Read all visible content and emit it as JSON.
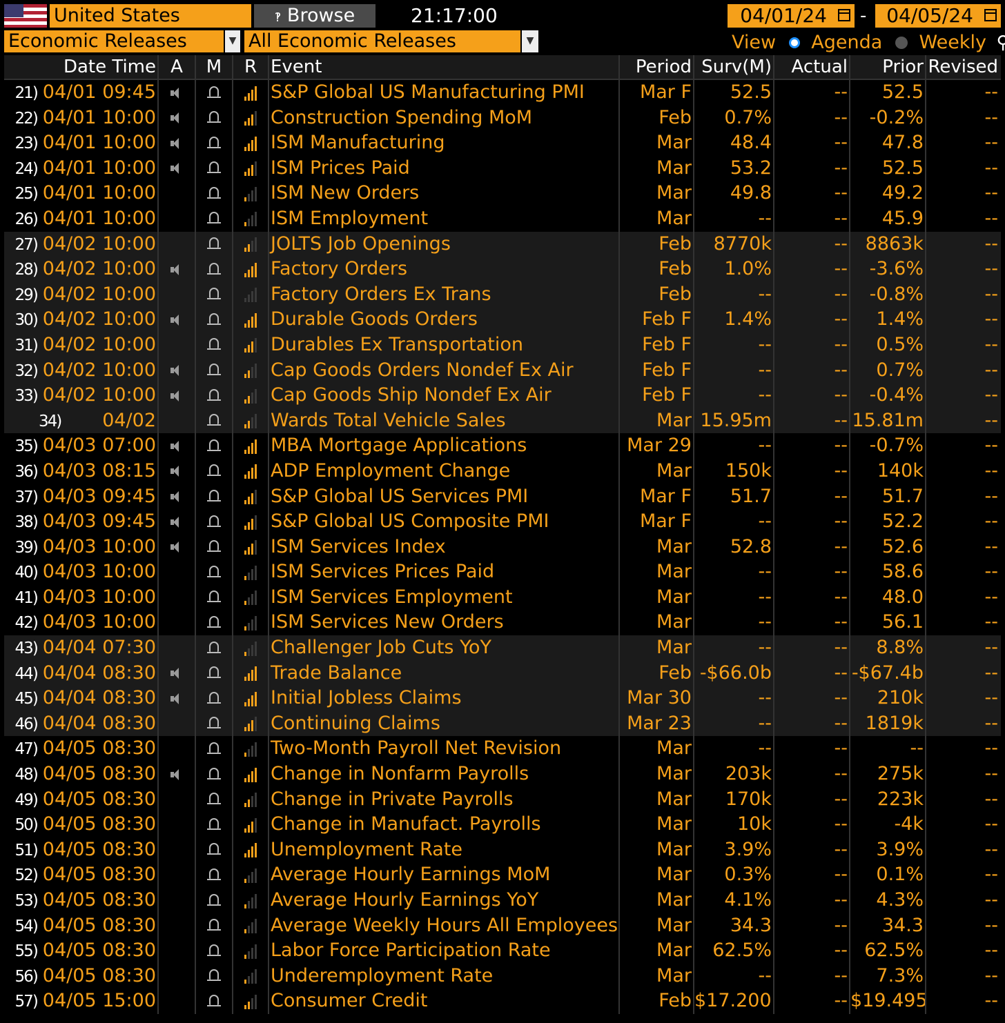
{
  "header": {
    "country": "United States",
    "browse_label": "Browse",
    "clock": "21:17:00",
    "date_from": "04/01/24",
    "date_to": "04/05/24",
    "date_separator": "-",
    "category": "Economic Releases",
    "filter": "All Economic Releases",
    "view_label": "View",
    "view_agenda": "Agenda",
    "view_weekly": "Weekly"
  },
  "columns": {
    "datetime": "Date Time",
    "a": "A",
    "m": "M",
    "r": "R",
    "event": "Event",
    "period": "Period",
    "surv": "Surv(M)",
    "actual": "Actual",
    "prior": "Prior",
    "revised": "Revised"
  },
  "rows": [
    {
      "num": "21)",
      "dt": "04/01 09:45",
      "alert": true,
      "rel": 4,
      "event": "S&P Global US Manufacturing PMI",
      "period": "Mar F",
      "surv": "52.5",
      "actual": "--",
      "prior": "52.5",
      "revised": "--"
    },
    {
      "num": "22)",
      "dt": "04/01 10:00",
      "alert": true,
      "rel": 3,
      "event": "Construction Spending MoM",
      "period": "Feb",
      "surv": "0.7%",
      "actual": "--",
      "prior": "-0.2%",
      "revised": "--"
    },
    {
      "num": "23)",
      "dt": "04/01 10:00",
      "alert": true,
      "rel": 4,
      "event": "ISM Manufacturing",
      "period": "Mar",
      "surv": "48.4",
      "actual": "--",
      "prior": "47.8",
      "revised": "--"
    },
    {
      "num": "24)",
      "dt": "04/01 10:00",
      "alert": true,
      "rel": 3,
      "event": "ISM Prices Paid",
      "period": "Mar",
      "surv": "53.2",
      "actual": "--",
      "prior": "52.5",
      "revised": "--"
    },
    {
      "num": "25)",
      "dt": "04/01 10:00",
      "alert": false,
      "rel": 1,
      "event": "ISM New Orders",
      "period": "Mar",
      "surv": "49.8",
      "actual": "--",
      "prior": "49.2",
      "revised": "--"
    },
    {
      "num": "26)",
      "dt": "04/01 10:00",
      "alert": false,
      "rel": 1,
      "event": "ISM Employment",
      "period": "Mar",
      "surv": "--",
      "actual": "--",
      "prior": "45.9",
      "revised": "--"
    },
    {
      "num": "27)",
      "dt": "04/02 10:00",
      "alert": false,
      "rel": 2,
      "event": "JOLTS Job Openings",
      "period": "Feb",
      "surv": "8770k",
      "actual": "--",
      "prior": "8863k",
      "revised": "--"
    },
    {
      "num": "28)",
      "dt": "04/02 10:00",
      "alert": true,
      "rel": 4,
      "event": "Factory Orders",
      "period": "Feb",
      "surv": "1.0%",
      "actual": "--",
      "prior": "-3.6%",
      "revised": "--"
    },
    {
      "num": "29)",
      "dt": "04/02 10:00",
      "alert": false,
      "rel": 0,
      "event": "Factory Orders Ex Trans",
      "period": "Feb",
      "surv": "--",
      "actual": "--",
      "prior": "-0.8%",
      "revised": "--"
    },
    {
      "num": "30)",
      "dt": "04/02 10:00",
      "alert": true,
      "rel": 4,
      "event": "Durable Goods Orders",
      "period": "Feb F",
      "surv": "1.4%",
      "actual": "--",
      "prior": "1.4%",
      "revised": "--"
    },
    {
      "num": "31)",
      "dt": "04/02 10:00",
      "alert": false,
      "rel": 3,
      "event": "Durables Ex Transportation",
      "period": "Feb F",
      "surv": "--",
      "actual": "--",
      "prior": "0.5%",
      "revised": "--"
    },
    {
      "num": "32)",
      "dt": "04/02 10:00",
      "alert": true,
      "rel": 2,
      "event": "Cap Goods Orders Nondef Ex Air",
      "period": "Feb F",
      "surv": "--",
      "actual": "--",
      "prior": "0.7%",
      "revised": "--"
    },
    {
      "num": "33)",
      "dt": "04/02 10:00",
      "alert": true,
      "rel": 2,
      "event": "Cap Goods Ship Nondef Ex Air",
      "period": "Feb F",
      "surv": "--",
      "actual": "--",
      "prior": "-0.4%",
      "revised": "--"
    },
    {
      "num": "34)",
      "dt": "04/02",
      "alert": false,
      "rel": 2,
      "event": "Wards Total Vehicle Sales",
      "period": "Mar",
      "surv": "15.95m",
      "actual": "--",
      "prior": "15.81m",
      "revised": "--"
    },
    {
      "num": "35)",
      "dt": "04/03 07:00",
      "alert": true,
      "rel": 4,
      "event": "MBA Mortgage Applications",
      "period": "Mar 29",
      "surv": "--",
      "actual": "--",
      "prior": "-0.7%",
      "revised": "--"
    },
    {
      "num": "36)",
      "dt": "04/03 08:15",
      "alert": true,
      "rel": 4,
      "event": "ADP Employment Change",
      "period": "Mar",
      "surv": "150k",
      "actual": "--",
      "prior": "140k",
      "revised": "--"
    },
    {
      "num": "37)",
      "dt": "04/03 09:45",
      "alert": true,
      "rel": 3,
      "event": "S&P Global US Services PMI",
      "period": "Mar F",
      "surv": "51.7",
      "actual": "--",
      "prior": "51.7",
      "revised": "--"
    },
    {
      "num": "38)",
      "dt": "04/03 09:45",
      "alert": true,
      "rel": 3,
      "event": "S&P Global US Composite PMI",
      "period": "Mar F",
      "surv": "--",
      "actual": "--",
      "prior": "52.2",
      "revised": "--"
    },
    {
      "num": "39)",
      "dt": "04/03 10:00",
      "alert": true,
      "rel": 3,
      "event": "ISM Services Index",
      "period": "Mar",
      "surv": "52.8",
      "actual": "--",
      "prior": "52.6",
      "revised": "--"
    },
    {
      "num": "40)",
      "dt": "04/03 10:00",
      "alert": false,
      "rel": 1,
      "event": "ISM Services Prices Paid",
      "period": "Mar",
      "surv": "--",
      "actual": "--",
      "prior": "58.6",
      "revised": "--"
    },
    {
      "num": "41)",
      "dt": "04/03 10:00",
      "alert": false,
      "rel": 1,
      "event": "ISM Services Employment",
      "period": "Mar",
      "surv": "--",
      "actual": "--",
      "prior": "48.0",
      "revised": "--"
    },
    {
      "num": "42)",
      "dt": "04/03 10:00",
      "alert": false,
      "rel": 1,
      "event": "ISM Services New Orders",
      "period": "Mar",
      "surv": "--",
      "actual": "--",
      "prior": "56.1",
      "revised": "--"
    },
    {
      "num": "43)",
      "dt": "04/04 07:30",
      "alert": false,
      "rel": 1,
      "event": "Challenger Job Cuts YoY",
      "period": "Mar",
      "surv": "--",
      "actual": "--",
      "prior": "8.8%",
      "revised": "--"
    },
    {
      "num": "44)",
      "dt": "04/04 08:30",
      "alert": true,
      "rel": 4,
      "event": "Trade Balance",
      "period": "Feb",
      "surv": "-$66.0b",
      "actual": "--",
      "prior": "-$67.4b",
      "revised": "--"
    },
    {
      "num": "45)",
      "dt": "04/04 08:30",
      "alert": true,
      "rel": 4,
      "event": "Initial Jobless Claims",
      "period": "Mar 30",
      "surv": "--",
      "actual": "--",
      "prior": "210k",
      "revised": "--"
    },
    {
      "num": "46)",
      "dt": "04/04 08:30",
      "alert": false,
      "rel": 3,
      "event": "Continuing Claims",
      "period": "Mar 23",
      "surv": "--",
      "actual": "--",
      "prior": "1819k",
      "revised": "--"
    },
    {
      "num": "47)",
      "dt": "04/05 08:30",
      "alert": false,
      "rel": 1,
      "event": "Two-Month Payroll Net Revision",
      "period": "Mar",
      "surv": "--",
      "actual": "--",
      "prior": "--",
      "revised": "--"
    },
    {
      "num": "48)",
      "dt": "04/05 08:30",
      "alert": true,
      "rel": 4,
      "event": "Change in Nonfarm Payrolls",
      "period": "Mar",
      "surv": "203k",
      "actual": "--",
      "prior": "275k",
      "revised": "--"
    },
    {
      "num": "49)",
      "dt": "04/05 08:30",
      "alert": false,
      "rel": 2,
      "event": "Change in Private Payrolls",
      "period": "Mar",
      "surv": "170k",
      "actual": "--",
      "prior": "223k",
      "revised": "--"
    },
    {
      "num": "50)",
      "dt": "04/05 08:30",
      "alert": false,
      "rel": 3,
      "event": "Change in Manufact. Payrolls",
      "period": "Mar",
      "surv": "10k",
      "actual": "--",
      "prior": "-4k",
      "revised": "--"
    },
    {
      "num": "51)",
      "dt": "04/05 08:30",
      "alert": false,
      "rel": 4,
      "event": "Unemployment Rate",
      "period": "Mar",
      "surv": "3.9%",
      "actual": "--",
      "prior": "3.9%",
      "revised": "--"
    },
    {
      "num": "52)",
      "dt": "04/05 08:30",
      "alert": false,
      "rel": 1,
      "event": "Average Hourly Earnings MoM",
      "period": "Mar",
      "surv": "0.3%",
      "actual": "--",
      "prior": "0.1%",
      "revised": "--"
    },
    {
      "num": "53)",
      "dt": "04/05 08:30",
      "alert": false,
      "rel": 1,
      "event": "Average Hourly Earnings YoY",
      "period": "Mar",
      "surv": "4.1%",
      "actual": "--",
      "prior": "4.3%",
      "revised": "--"
    },
    {
      "num": "54)",
      "dt": "04/05 08:30",
      "alert": false,
      "rel": 1,
      "event": "Average Weekly Hours All Employees",
      "period": "Mar",
      "surv": "34.3",
      "actual": "--",
      "prior": "34.3",
      "revised": "--"
    },
    {
      "num": "55)",
      "dt": "04/05 08:30",
      "alert": false,
      "rel": 1,
      "event": "Labor Force Participation Rate",
      "period": "Mar",
      "surv": "62.5%",
      "actual": "--",
      "prior": "62.5%",
      "revised": "--"
    },
    {
      "num": "56)",
      "dt": "04/05 08:30",
      "alert": false,
      "rel": 1,
      "event": "Underemployment Rate",
      "period": "Mar",
      "surv": "--",
      "actual": "--",
      "prior": "7.3%",
      "revised": "--"
    },
    {
      "num": "57)",
      "dt": "04/05 15:00",
      "alert": false,
      "rel": 2,
      "event": "Consumer Credit",
      "period": "Feb",
      "surv": "$17.200b",
      "actual": "--",
      "prior": "$19.495",
      "revised": "--"
    }
  ],
  "shaded_dates": [
    "04/02",
    "04/04"
  ],
  "colors": {
    "accent": "#f5a01a",
    "background": "#000000",
    "shade": "#1b1b1b"
  }
}
